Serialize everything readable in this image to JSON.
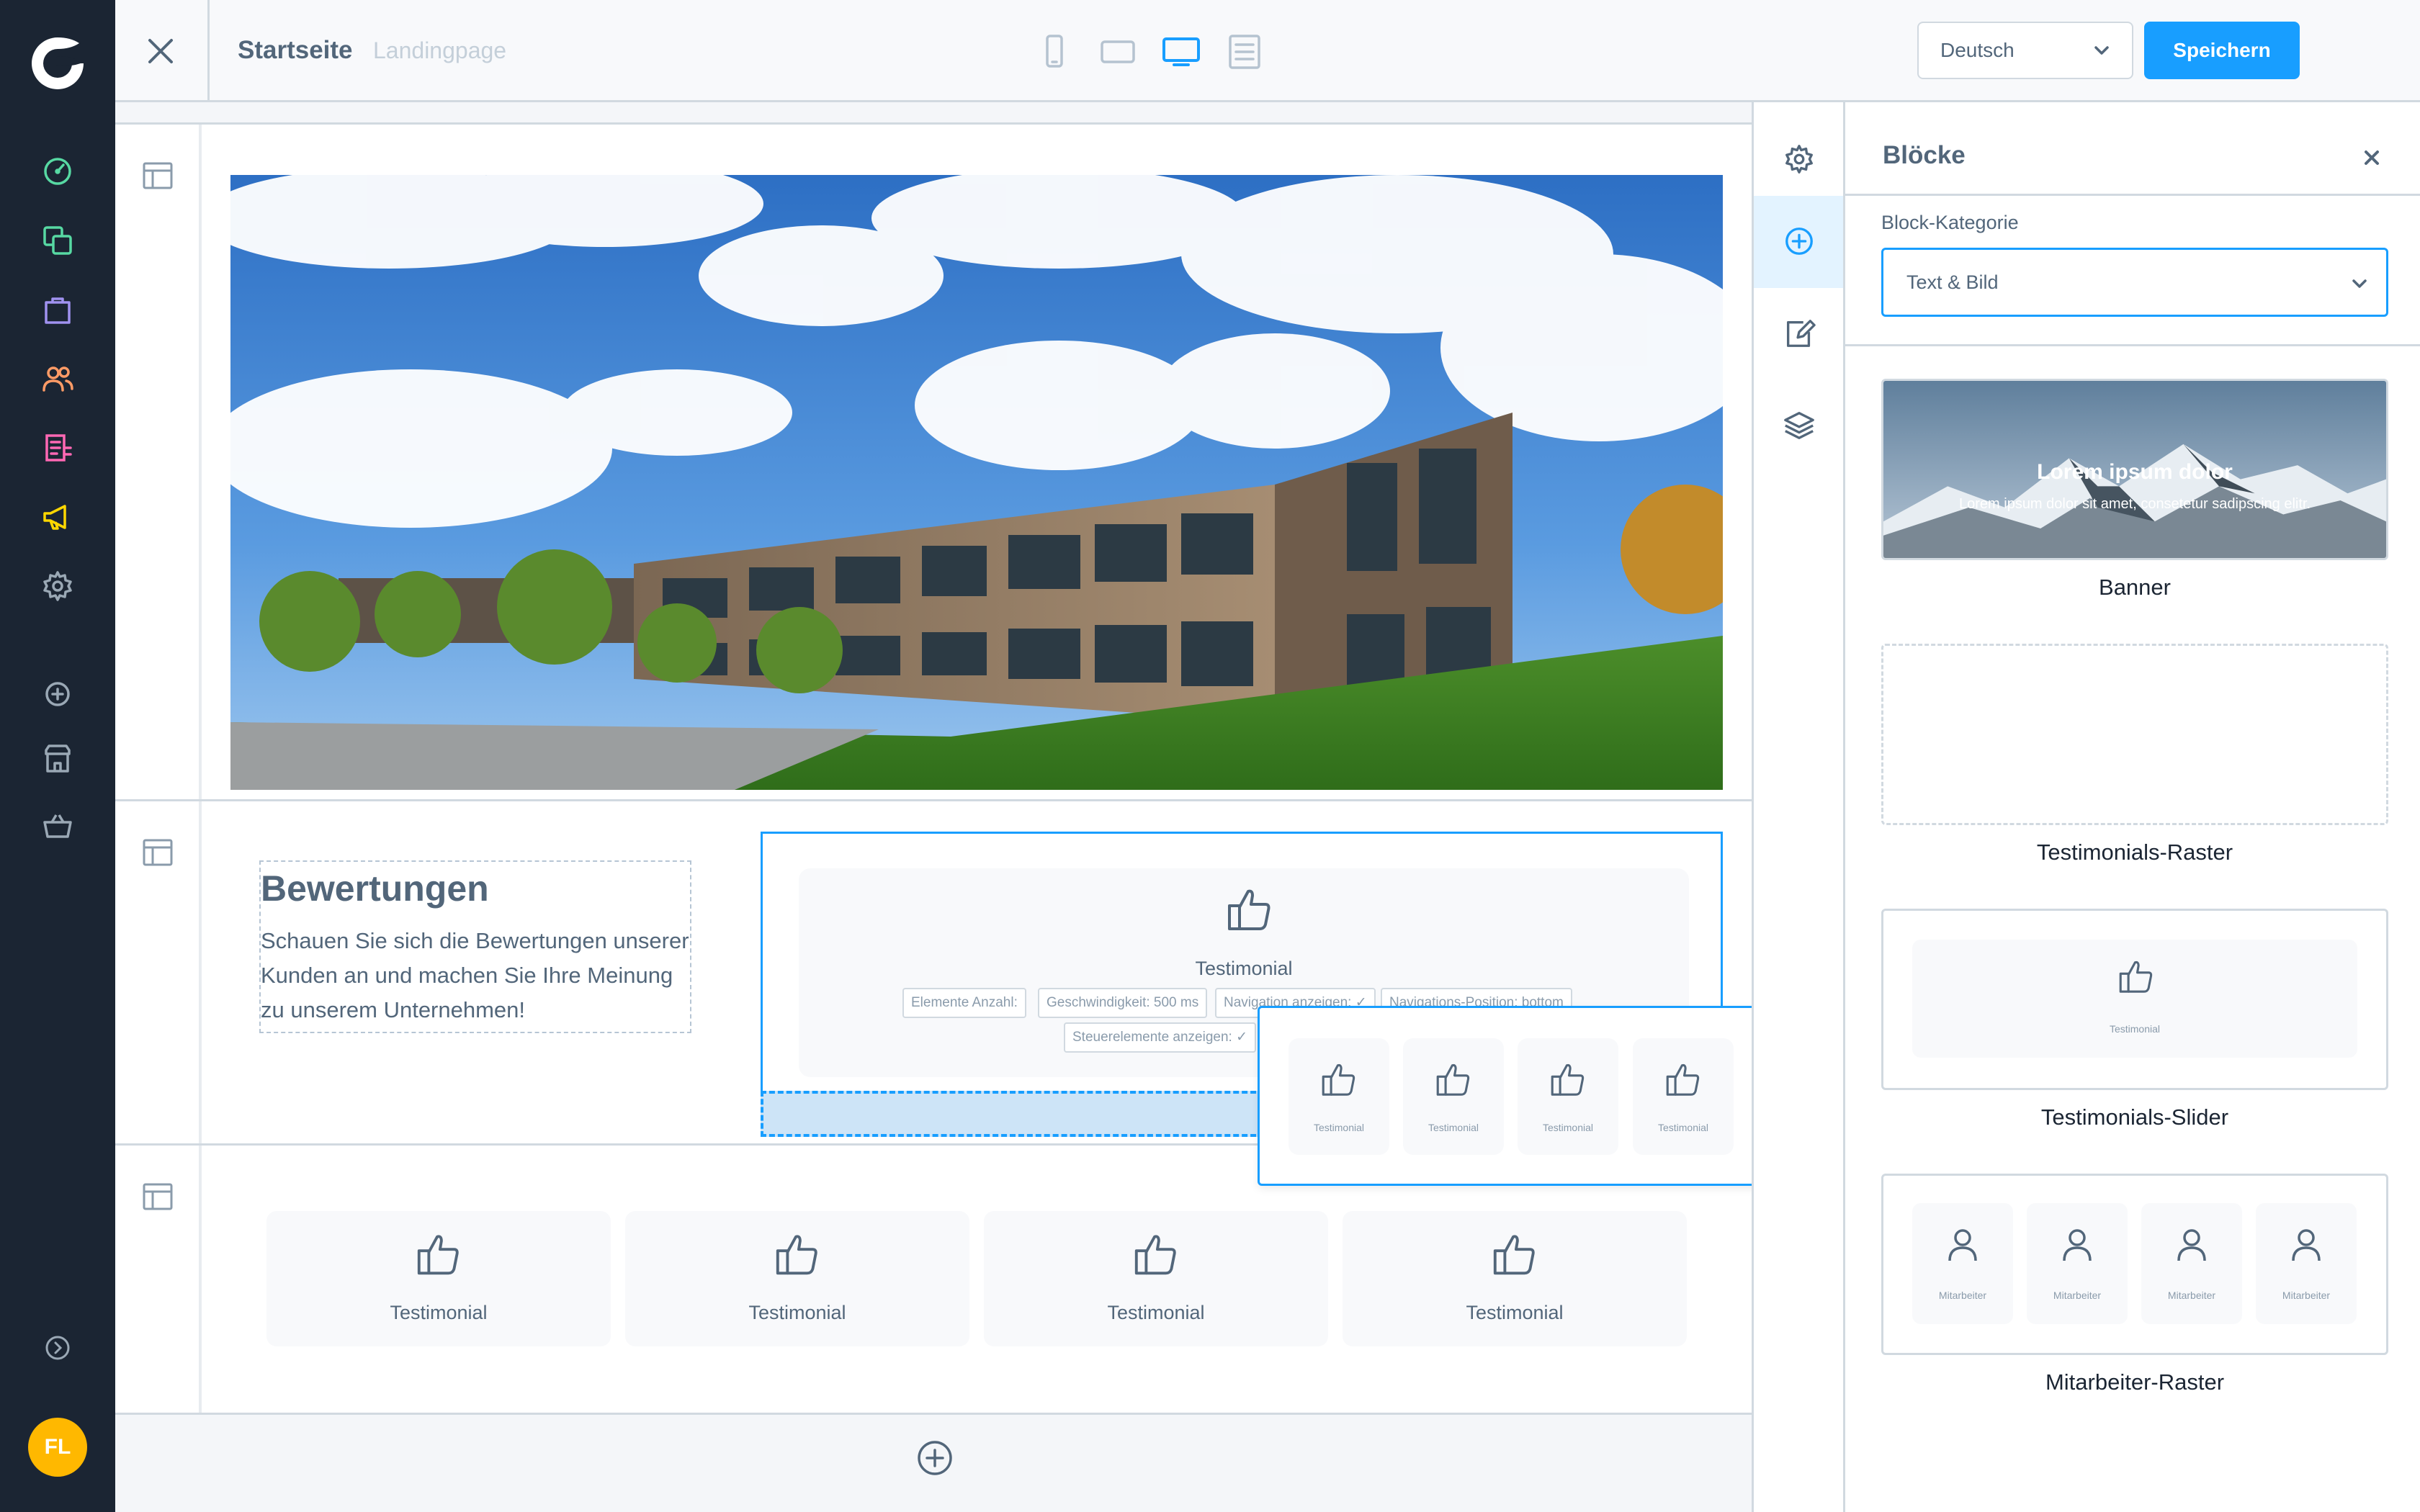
{
  "app": {
    "user_initials": "FL",
    "accent_color": "#189eff",
    "sidebar_bg": "#1b2533",
    "sidebar_icons": [
      {
        "name": "dashboard-icon",
        "color": "#57d9a3"
      },
      {
        "name": "catalogues-icon",
        "color": "#57d9a3"
      },
      {
        "name": "orders-icon",
        "color": "#a092f0"
      },
      {
        "name": "customers-icon",
        "color": "#ff9b66"
      },
      {
        "name": "content-icon",
        "color": "#ff68b4"
      },
      {
        "name": "marketing-icon",
        "color": "#ffd700"
      },
      {
        "name": "settings-icon",
        "color": "#9aa8b5"
      },
      {
        "name": "extensions-add-icon",
        "color": "#9aa8b5"
      },
      {
        "name": "store-icon",
        "color": "#9aa8b5"
      },
      {
        "name": "basket-icon",
        "color": "#9aa8b5"
      },
      {
        "name": "expand-sidebar-icon",
        "color": "#9aa8b5"
      }
    ]
  },
  "topbar": {
    "title": "Startseite",
    "subtitle": "Landingpage",
    "view_modes": [
      "mobile-view-icon",
      "tablet-view-icon",
      "desktop-view-icon",
      "form-view-icon"
    ],
    "active_view": "desktop-view-icon",
    "language": "Deutsch",
    "save_label": "Speichern"
  },
  "canvas": {
    "reviews": {
      "title": "Bewertungen",
      "text": "Schauen Sie sich die Bewertungen unserer Kunden an und machen Sie Ihre Meinung zu unserem Unternehmen!"
    },
    "slider": {
      "label": "Testimonial",
      "chips": [
        "Elemente Anzahl:",
        "Geschwindigkeit: 500 ms",
        "Navigation anzeigen: ✓",
        "Navigations-Position: bottom",
        "Steuerelemente anzeigen: ✓"
      ]
    },
    "drag_ghost": {
      "cards": [
        "Testimonial",
        "Testimonial",
        "Testimonial",
        "Testimonial"
      ]
    },
    "grid": {
      "cards": [
        "Testimonial",
        "Testimonial",
        "Testimonial",
        "Testimonial"
      ]
    }
  },
  "tool_strip": {
    "tools": [
      "settings-icon",
      "add-block-icon",
      "edit-icon",
      "layers-icon"
    ],
    "active_tool": "add-block-icon"
  },
  "blocks_panel": {
    "title": "Blöcke",
    "category_label": "Block-Kategorie",
    "category_value": "Text & Bild",
    "blocks": [
      {
        "name": "Banner",
        "preview_title": "Lorem ipsum dolor",
        "preview_text": "Lorem ipsum dolor sit amet, consetetur sadipscing elitr."
      },
      {
        "name": "Testimonials-Raster"
      },
      {
        "name": "Testimonials-Slider",
        "preview_label": "Testimonial"
      },
      {
        "name": "Mitarbeiter-Raster",
        "preview_labels": [
          "Mitarbeiter",
          "Mitarbeiter",
          "Mitarbeiter",
          "Mitarbeiter"
        ]
      }
    ]
  }
}
